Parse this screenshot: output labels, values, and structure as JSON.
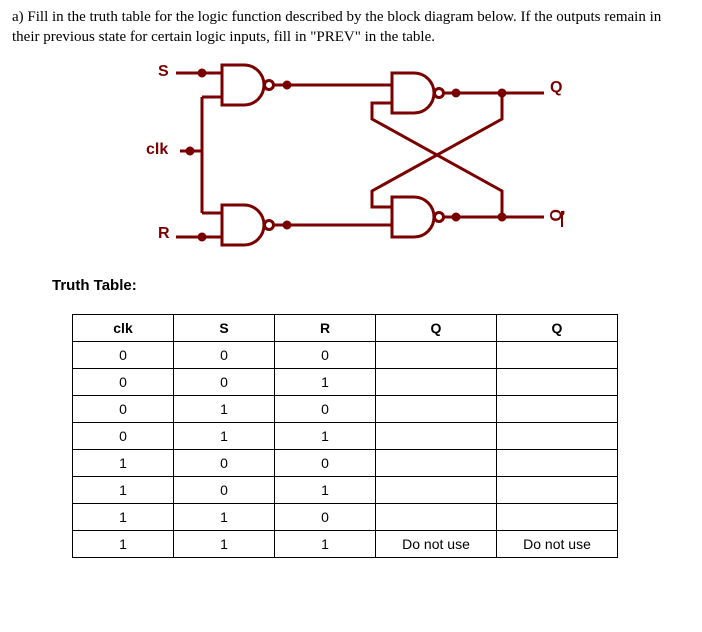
{
  "prompt": "a) Fill in the truth table for the logic function described by the block diagram below.  If the outputs remain in their previous state for certain logic inputs, fill in \"PREV\" in the table.",
  "diagram": {
    "labels": {
      "s": "S",
      "clk": "clk",
      "r": "R",
      "q": "Q",
      "qbar": "Q"
    }
  },
  "truth_table": {
    "title": "Truth Table:",
    "headers": {
      "clk": "clk",
      "s": "S",
      "r": "R",
      "q": "Q",
      "qbar": "Q"
    },
    "rows": [
      {
        "clk": "0",
        "s": "0",
        "r": "0",
        "q": "",
        "qbar": ""
      },
      {
        "clk": "0",
        "s": "0",
        "r": "1",
        "q": "",
        "qbar": ""
      },
      {
        "clk": "0",
        "s": "1",
        "r": "0",
        "q": "",
        "qbar": ""
      },
      {
        "clk": "0",
        "s": "1",
        "r": "1",
        "q": "",
        "qbar": ""
      },
      {
        "clk": "1",
        "s": "0",
        "r": "0",
        "q": "",
        "qbar": ""
      },
      {
        "clk": "1",
        "s": "0",
        "r": "1",
        "q": "",
        "qbar": ""
      },
      {
        "clk": "1",
        "s": "1",
        "r": "0",
        "q": "",
        "qbar": ""
      },
      {
        "clk": "1",
        "s": "1",
        "r": "1",
        "q": "Do not use",
        "qbar": "Do not use"
      }
    ]
  }
}
